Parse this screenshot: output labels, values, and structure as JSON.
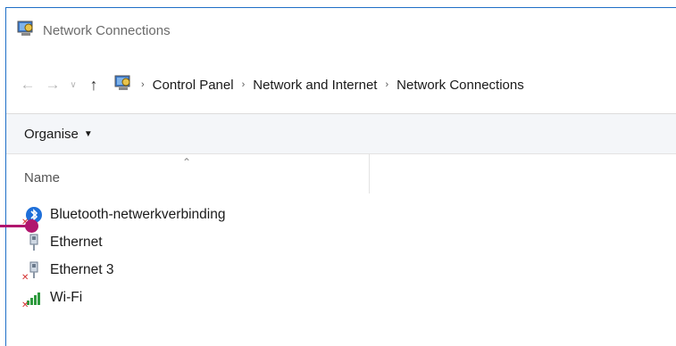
{
  "window": {
    "title": "Network Connections",
    "accent_color": "#1f6fc7",
    "title_icon": "network-connections-icon"
  },
  "address_bar": {
    "back_icon": "arrow-left-icon",
    "forward_icon": "arrow-right-icon",
    "recent_icon": "chevron-down-icon",
    "up_icon": "arrow-up-icon",
    "location_icon": "control-panel-network-icon",
    "breadcrumbs": [
      "Control Panel",
      "Network and Internet",
      "Network Connections"
    ]
  },
  "command_bar": {
    "organise_label": "Organise"
  },
  "columns": {
    "name_label": "Name",
    "sort": "ascending"
  },
  "items": [
    {
      "label": "Bluetooth-netwerkverbinding",
      "icon": "bluetooth-icon",
      "disconnected": true
    },
    {
      "label": "Ethernet",
      "icon": "ethernet-icon",
      "disconnected": false
    },
    {
      "label": "Ethernet 3",
      "icon": "ethernet-icon",
      "disconnected": true
    },
    {
      "label": "Wi-Fi",
      "icon": "wifi-signal-icon",
      "disconnected": true
    }
  ],
  "annotation": {
    "marker_color": "#b0166e"
  }
}
